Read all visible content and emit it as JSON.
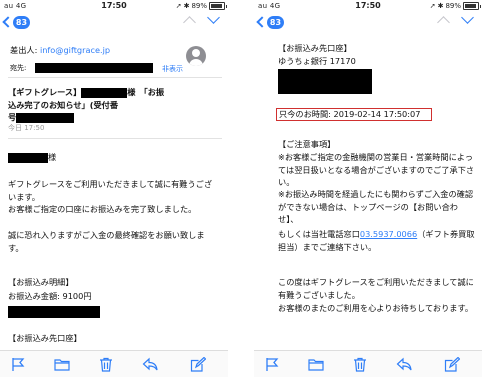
{
  "status": {
    "carrier": "au",
    "network": "4G",
    "time": "17:50",
    "battery_percent": "89%",
    "battery_level": 0.89
  },
  "nav": {
    "unread_count": "83"
  },
  "left": {
    "from_label": "差出人:",
    "from_address": "info@giftgrace.jp",
    "to_label": "宛先:",
    "hide_label": "非表示",
    "subject_line1_a": "【ギフトグレース】",
    "subject_line1_b": "様　「お振",
    "subject_line2": "込み完了のお知らせ」(受付番",
    "subject_line3": "号",
    "date": "今日 17:50",
    "sama": "様",
    "body1": "ギフトグレースをご利用いただきまして誠に有難うございます。",
    "body2": "お客様ご指定の口座にお振込みを完了致しました。",
    "body3": "誠に恐れ入りますがご入金の最終確認をお願い致します。",
    "detail_header": "【お振込み明細】",
    "amount": "お振込み金額: 9100円",
    "account_header": "【お振込み先口座】"
  },
  "right": {
    "account_header": "【お振込み先口座】",
    "bank": "ゆうちょ銀行 17170",
    "time_label": "只今のお時間: 2019-02-14 17:50:07",
    "notes_header": "【ご注意事項】",
    "note1": "※お客様ご指定の金融機関の営業日・営業時間によっては翌日扱いとなる場合がございますのでご了承下さい。",
    "note2": "※お振込み時間を経過したにも関わらずご入金の確認ができない場合は、トップページの【お問い合わせ】、",
    "phone_prefix": "もしくは当社電話窓口",
    "phone": "03.5937.0066",
    "phone_suffix": "（ギフト券買取担当）までご連絡下さい。",
    "closing1": "この度はギフトグレースをご利用いただきまして誠に有難うございました。",
    "closing2": "お客様のまたのご利用を心よりお待ちしております。"
  },
  "colors": {
    "accent": "#2f7ef7",
    "highlight_border": "#d0302f"
  },
  "icons": [
    "flag-icon",
    "folder-icon",
    "trash-icon",
    "reply-icon",
    "compose-icon"
  ]
}
